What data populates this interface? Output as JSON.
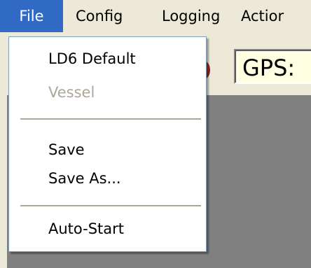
{
  "menubar": {
    "items": [
      {
        "label": "File",
        "active": true
      },
      {
        "label": "Config",
        "active": false
      },
      {
        "label": "Logging",
        "active": false
      },
      {
        "label": "Actior",
        "active": false
      }
    ]
  },
  "toolbar": {
    "gps_label": "GPS:"
  },
  "file_menu": {
    "items": [
      {
        "label": "LD6 Default",
        "enabled": true
      },
      {
        "label": "Vessel",
        "enabled": false
      },
      {
        "label": "Save",
        "enabled": true
      },
      {
        "label": "Save As...",
        "enabled": true
      },
      {
        "label": "Auto-Start",
        "enabled": true
      }
    ]
  },
  "colors": {
    "menu_highlight": "#316ac5",
    "menu_bar_bg": "#ece9d8",
    "workspace_bg": "#808080",
    "disabled_text": "#aca899",
    "gps_box_bg": "#ffffe1",
    "led": "#b02a1c"
  }
}
